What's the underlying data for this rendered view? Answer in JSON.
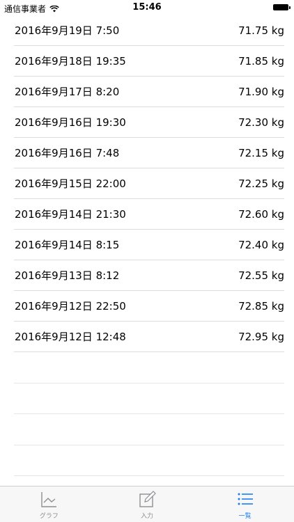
{
  "status_bar": {
    "carrier": "通信事業者",
    "time": "15:46"
  },
  "entries": [
    {
      "date": "2016年9月19日 7:50",
      "weight": "71.75 kg"
    },
    {
      "date": "2016年9月18日 19:35",
      "weight": "71.85 kg"
    },
    {
      "date": "2016年9月17日 8:20",
      "weight": "71.90 kg"
    },
    {
      "date": "2016年9月16日 19:30",
      "weight": "72.30 kg"
    },
    {
      "date": "2016年9月16日 7:48",
      "weight": "72.15 kg"
    },
    {
      "date": "2016年9月15日 22:00",
      "weight": "72.25 kg"
    },
    {
      "date": "2016年9月14日 21:30",
      "weight": "72.60 kg"
    },
    {
      "date": "2016年9月14日 8:15",
      "weight": "72.40 kg"
    },
    {
      "date": "2016年9月13日 8:12",
      "weight": "72.55 kg"
    },
    {
      "date": "2016年9月12日 22:50",
      "weight": "72.85 kg"
    },
    {
      "date": "2016年9月12日 12:48",
      "weight": "72.95 kg"
    }
  ],
  "tab_bar": {
    "tabs": [
      {
        "label": "グラフ",
        "icon": "graph-icon",
        "active": false
      },
      {
        "label": "入力",
        "icon": "edit-icon",
        "active": false
      },
      {
        "label": "一覧",
        "icon": "list-icon",
        "active": true
      }
    ]
  },
  "colors": {
    "accent": "#1a7cf5",
    "inactive": "#8e8e93"
  }
}
